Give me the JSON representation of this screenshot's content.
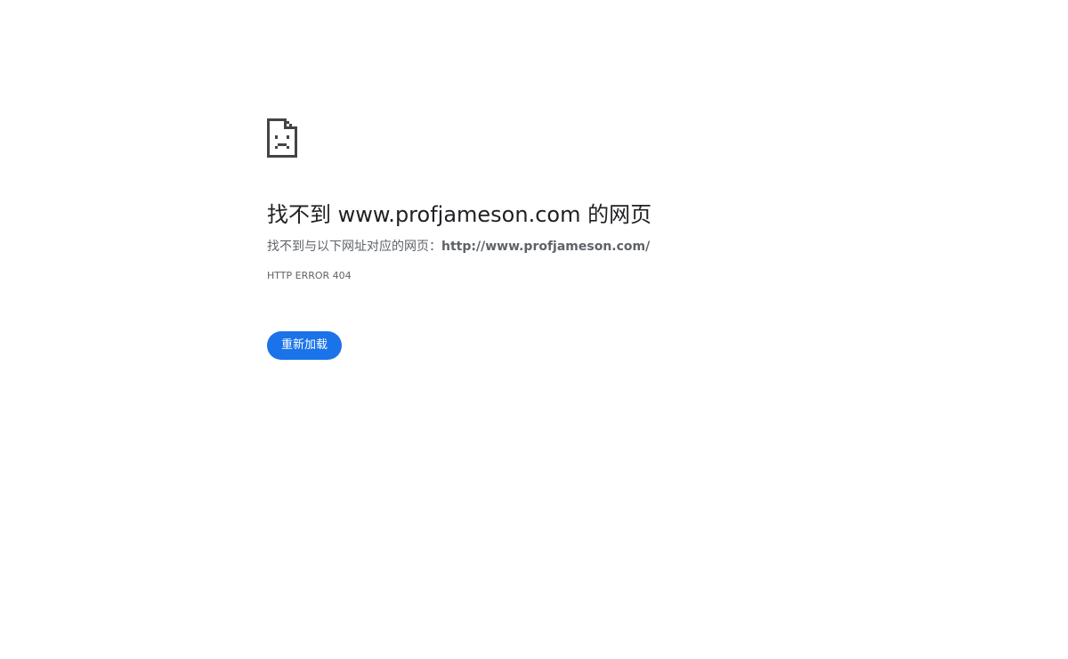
{
  "icon": "sad-page-icon",
  "error": {
    "title": "找不到 www.profjameson.com 的网页",
    "description_prefix": "找不到与以下网址对应的网页：",
    "description_url": "http://www.profjameson.com/",
    "code": "HTTP ERROR 404"
  },
  "actions": {
    "reload_label": "重新加载"
  },
  "colors": {
    "accent": "#1a73e8",
    "title_text": "#202124",
    "secondary_text": "#5f6368",
    "icon": "#444444"
  }
}
